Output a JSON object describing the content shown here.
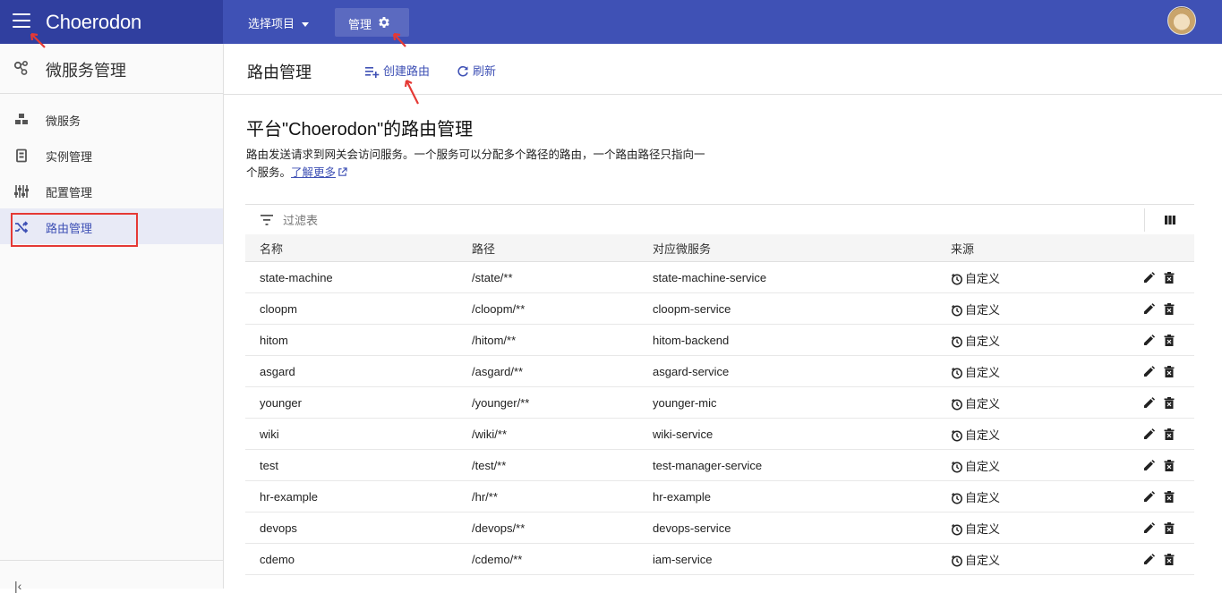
{
  "header": {
    "brand": "Choerodon",
    "project_select": "选择项目",
    "manage_label": "管理"
  },
  "sidebar": {
    "title": "微服务管理",
    "items": [
      {
        "label": "微服务",
        "icon": "cubes-icon"
      },
      {
        "label": "实例管理",
        "icon": "instance-icon"
      },
      {
        "label": "配置管理",
        "icon": "sliders-icon"
      },
      {
        "label": "路由管理",
        "icon": "shuffle-icon",
        "active": true
      }
    ]
  },
  "page": {
    "title": "路由管理",
    "create_label": "创建路由",
    "refresh_label": "刷新",
    "content_title": "平台\"Choerodon\"的路由管理",
    "description": "路由发送请求到网关会访问服务。一个服务可以分配多个路径的路由，一个路由路径只指向一个服务。",
    "learn_more": "了解更多"
  },
  "table": {
    "filter_placeholder": "过滤表",
    "columns": [
      "名称",
      "路径",
      "对应微服务",
      "来源"
    ],
    "rows": [
      {
        "name": "state-machine",
        "path": "/state/**",
        "service": "state-machine-service",
        "source": "自定义"
      },
      {
        "name": "cloopm",
        "path": "/cloopm/**",
        "service": "cloopm-service",
        "source": "自定义"
      },
      {
        "name": "hitom",
        "path": "/hitom/**",
        "service": "hitom-backend",
        "source": "自定义"
      },
      {
        "name": "asgard",
        "path": "/asgard/**",
        "service": "asgard-service",
        "source": "自定义"
      },
      {
        "name": "younger",
        "path": "/younger/**",
        "service": "younger-mic",
        "source": "自定义"
      },
      {
        "name": "wiki",
        "path": "/wiki/**",
        "service": "wiki-service",
        "source": "自定义"
      },
      {
        "name": "test",
        "path": "/test/**",
        "service": "test-manager-service",
        "source": "自定义"
      },
      {
        "name": "hr-example",
        "path": "/hr/**",
        "service": "hr-example",
        "source": "自定义"
      },
      {
        "name": "devops",
        "path": "/devops/**",
        "service": "devops-service",
        "source": "自定义"
      },
      {
        "name": "cdemo",
        "path": "/cdemo/**",
        "service": "iam-service",
        "source": "自定义"
      }
    ]
  },
  "colors": {
    "primary": "#3f51b5",
    "primary_dark": "#303f9f",
    "annotation_red": "#e53935"
  }
}
